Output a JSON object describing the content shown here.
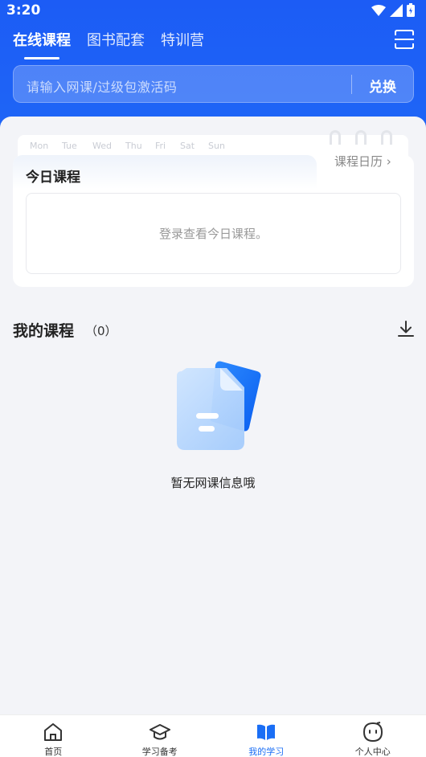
{
  "status": {
    "time": "3:20"
  },
  "header": {
    "tabs": [
      {
        "label": "在线课程"
      },
      {
        "label": "图书配套"
      },
      {
        "label": "特训营"
      }
    ],
    "search": {
      "placeholder": "请输入网课/过级包激活码",
      "button_label": "兑换"
    }
  },
  "calendar": {
    "weekdays": [
      "Mon",
      "Tue",
      "Wed",
      "Thu",
      "Fri",
      "Sat",
      "Sun"
    ],
    "link_label": "课程日历 ›",
    "today_title": "今日课程",
    "today_message": "登录查看今日课程。"
  },
  "my_courses": {
    "title": "我的课程",
    "count": "（0）",
    "empty_message": "暂无网课信息哦"
  },
  "bottom_nav": {
    "items": [
      {
        "label": "首页",
        "icon": "home-icon"
      },
      {
        "label": "学习备考",
        "icon": "graduation-cap-icon"
      },
      {
        "label": "我的学习",
        "icon": "book-icon"
      },
      {
        "label": "个人中心",
        "icon": "profile-face-icon"
      }
    ],
    "active_index": 2
  },
  "colors": {
    "brand": "#1c5cf5",
    "active_nav": "#1a6ef5"
  }
}
